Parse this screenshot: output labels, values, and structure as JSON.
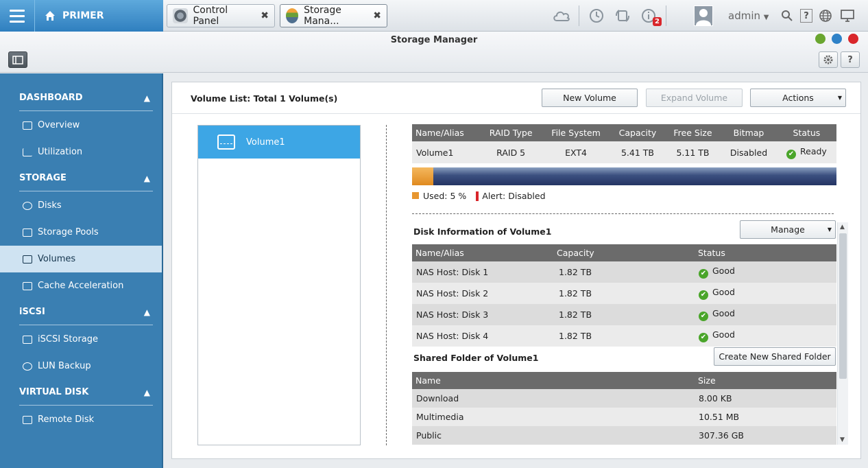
{
  "topbar": {
    "home_label": "PRIMER",
    "tabs": [
      {
        "label": "Control Panel",
        "icon": "gear-icon"
      },
      {
        "label": "Storage Mana...",
        "icon": "storage-manager-icon"
      }
    ],
    "notification_count": "2",
    "username": "admin"
  },
  "window": {
    "title": "Storage Manager"
  },
  "sidebar": {
    "sections": [
      {
        "label": "DASHBOARD",
        "items": [
          "Overview",
          "Utilization"
        ]
      },
      {
        "label": "STORAGE",
        "items": [
          "Disks",
          "Storage Pools",
          "Volumes",
          "Cache Acceleration"
        ]
      },
      {
        "label": "iSCSI",
        "items": [
          "iSCSI Storage",
          "LUN Backup"
        ]
      },
      {
        "label": "VIRTUAL DISK",
        "items": [
          "Remote Disk"
        ]
      }
    ],
    "active_item": "Volumes"
  },
  "main": {
    "volume_list_title": "Volume List: Total 1 Volume(s)",
    "buttons": {
      "new_volume": "New Volume",
      "expand_volume": "Expand Volume",
      "actions": "Actions"
    },
    "volumes": [
      "Volume1"
    ],
    "volume_table": {
      "headers": [
        "Name/Alias",
        "RAID Type",
        "File System",
        "Capacity",
        "Free Size",
        "Bitmap",
        "Status"
      ],
      "row": [
        "Volume1",
        "RAID 5",
        "EXT4",
        "5.41 TB",
        "5.11 TB",
        "Disabled",
        "Ready"
      ]
    },
    "usage": {
      "used_percent": 5,
      "used_label": "Used: 5 %",
      "alert_label": "Alert: Disabled",
      "used_color": "#e7962f",
      "alert_color": "#d9262b"
    },
    "disk_info": {
      "title": "Disk Information of Volume1",
      "manage_label": "Manage",
      "headers": [
        "Name/Alias",
        "Capacity",
        "Status"
      ],
      "rows": [
        [
          "NAS Host: Disk 1",
          "1.82 TB",
          "Good"
        ],
        [
          "NAS Host: Disk 2",
          "1.82 TB",
          "Good"
        ],
        [
          "NAS Host: Disk 3",
          "1.82 TB",
          "Good"
        ],
        [
          "NAS Host: Disk 4",
          "1.82 TB",
          "Good"
        ]
      ]
    },
    "shared_folders": {
      "title": "Shared Folder of Volume1",
      "create_label": "Create New Shared Folder",
      "headers": [
        "Name",
        "Size"
      ],
      "rows": [
        [
          "Download",
          "8.00 KB"
        ],
        [
          "Multimedia",
          "10.51 MB"
        ],
        [
          "Public",
          "307.36 GB"
        ]
      ]
    }
  },
  "colors": {
    "accent": "#3da6e5",
    "sidebar": "#3a7fb2",
    "header_row": "#6b6b6b",
    "status_ok": "#4aa52a"
  }
}
